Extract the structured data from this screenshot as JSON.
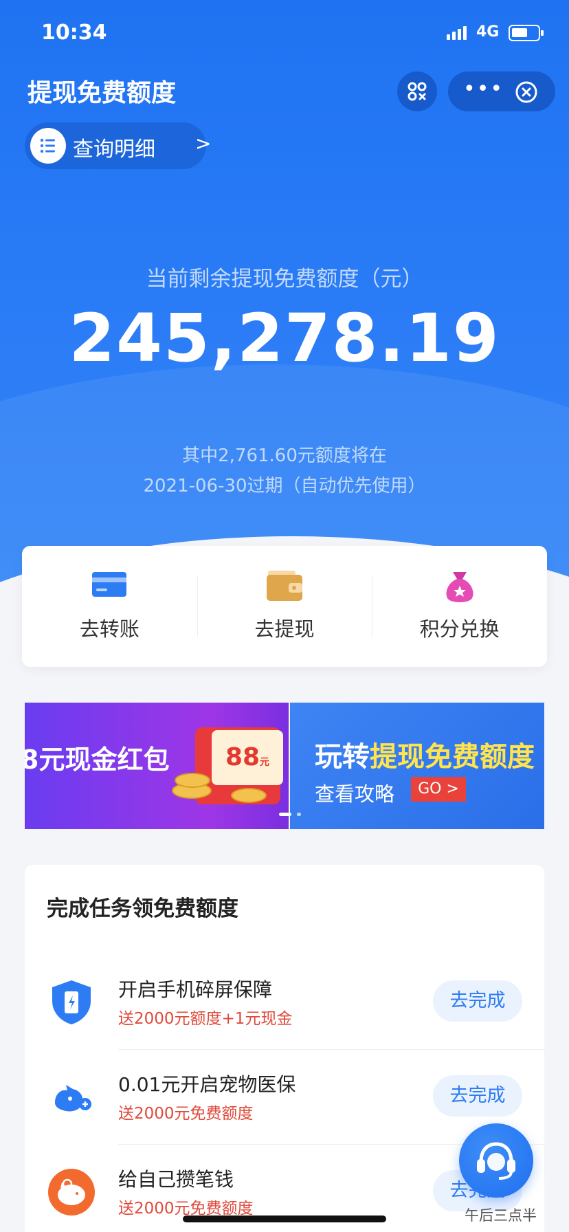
{
  "status_bar": {
    "time": "10:34",
    "network": "4G"
  },
  "header": {
    "title": "提现免费额度"
  },
  "detail_link": {
    "label": "查询明细",
    "chevron": ">"
  },
  "balance": {
    "label": "当前剩余提现免费额度（元）",
    "amount": "245,278.19",
    "expire_line1": "其中2,761.60元额度将在",
    "expire_line2": "2021-06-30过期（自动优先使用）"
  },
  "actions": [
    {
      "label": "去转账",
      "icon": "card-icon"
    },
    {
      "label": "去提现",
      "icon": "wallet-icon"
    },
    {
      "label": "积分兑换",
      "icon": "money-bag-icon"
    }
  ],
  "banners": {
    "left": {
      "text": "8元现金红包",
      "card_value": "88",
      "card_unit": "元"
    },
    "right": {
      "title_prefix": "玩转",
      "title_highlight": "提现免费额度",
      "subtitle": "查看攻略",
      "go_label": "GO >"
    }
  },
  "tasks": {
    "title": "完成任务领免费额度",
    "items": [
      {
        "name": "开启手机碎屏保障",
        "reward": "送2000元额度+1元现金",
        "button": "去完成",
        "icon": "phone-shield-icon"
      },
      {
        "name": "0.01元开启宠物医保",
        "reward": "送2000元免费额度",
        "button": "去完成",
        "icon": "pet-icon"
      },
      {
        "name": "给自己攒笔钱",
        "reward": "送2000元免费额度",
        "button": "去完成",
        "icon": "piggy-bank-icon"
      }
    ]
  },
  "watermark": "午后三点半",
  "colors": {
    "primary": "#1f73f2",
    "reward_red": "#e04a3a",
    "button_blue": "#2d7cf3"
  }
}
